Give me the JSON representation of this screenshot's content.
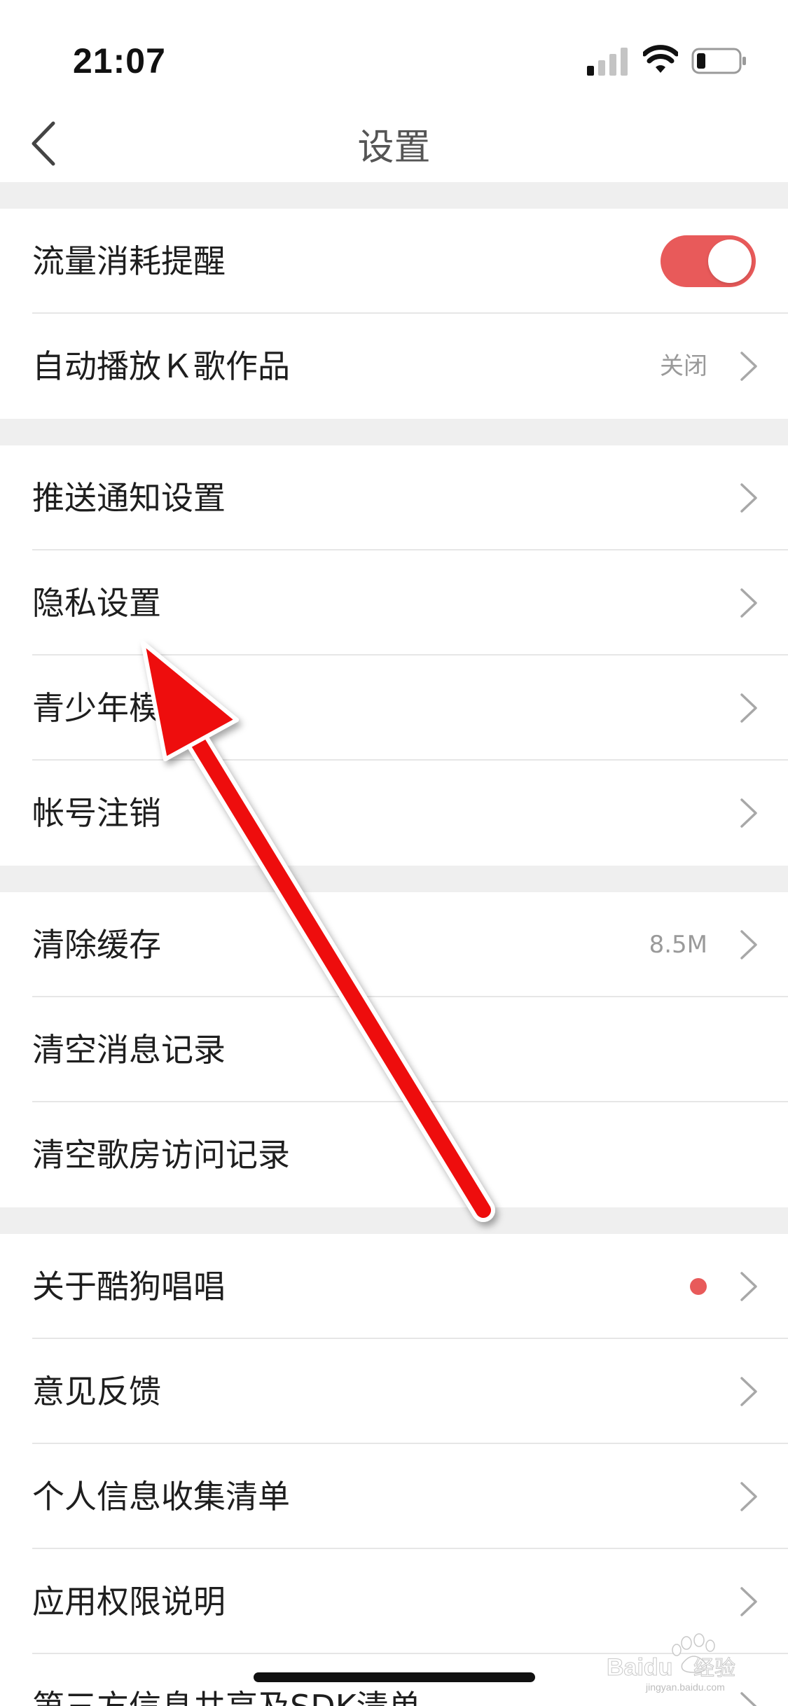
{
  "status": {
    "time": "21:07",
    "icons": [
      "signal-icon",
      "wifi-icon",
      "battery-icon"
    ]
  },
  "header": {
    "title": "设置",
    "back_icon": "chevron-left-icon"
  },
  "sections": [
    {
      "rows": [
        {
          "label": "流量消耗提醒",
          "control": "toggle",
          "toggle_on": true
        },
        {
          "label": "自动播放Ｋ歌作品",
          "value": "关闭",
          "control": "chevron"
        }
      ]
    },
    {
      "rows": [
        {
          "label": "推送通知设置",
          "control": "chevron"
        },
        {
          "label": "隐私设置",
          "control": "chevron"
        },
        {
          "label": "青少年模式",
          "control": "chevron"
        },
        {
          "label": "帐号注销",
          "control": "chevron"
        }
      ]
    },
    {
      "rows": [
        {
          "label": "清除缓存",
          "value": "8.5M",
          "control": "chevron"
        },
        {
          "label": "清空消息记录",
          "control": "none"
        },
        {
          "label": "清空歌房访问记录",
          "control": "none"
        }
      ]
    },
    {
      "rows": [
        {
          "label": "关于酷狗唱唱",
          "control": "chevron",
          "badge": "red-dot"
        },
        {
          "label": "意见反馈",
          "control": "chevron"
        },
        {
          "label": "个人信息收集清单",
          "control": "chevron"
        },
        {
          "label": "应用权限说明",
          "control": "chevron"
        },
        {
          "label": "第三方信息共享及SDK清单",
          "control": "chevron"
        }
      ]
    }
  ],
  "colors": {
    "accent": "#e85a5a",
    "separator_bg": "#efefef",
    "annotation_arrow": "#ee1111"
  },
  "watermark": {
    "brand": "Baidu经验",
    "domain": "jingyan.baidu.com"
  }
}
